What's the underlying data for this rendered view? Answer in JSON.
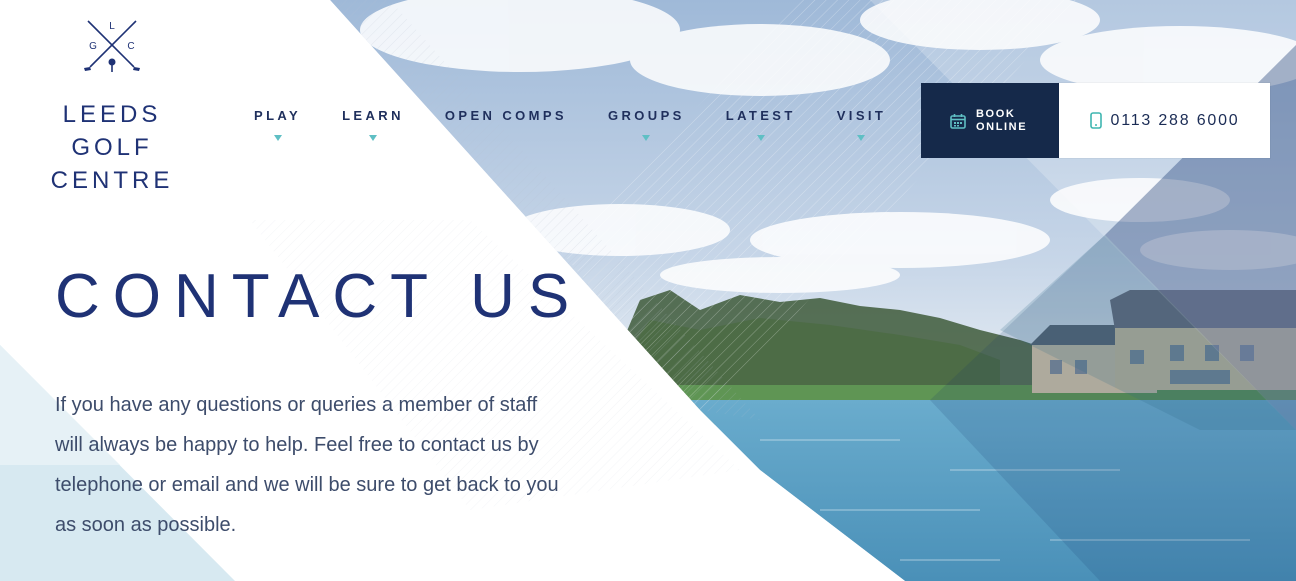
{
  "logo": {
    "initial_top": "L",
    "initial_left": "G",
    "initial_right": "C",
    "name_line_1": "LEEDS GOLF",
    "name_line_2": "CENTRE"
  },
  "nav": {
    "items": [
      {
        "label": "PLAY",
        "has_dropdown": true
      },
      {
        "label": "LEARN",
        "has_dropdown": true
      },
      {
        "label": "OPEN COMPS",
        "has_dropdown": false
      },
      {
        "label": "GROUPS",
        "has_dropdown": true
      },
      {
        "label": "LATEST",
        "has_dropdown": true
      },
      {
        "label": "VISIT",
        "has_dropdown": true
      }
    ]
  },
  "cta": {
    "book_label": "BOOK ONLINE",
    "book_icon": "calendar-icon",
    "phone_label": "0113 288 6000",
    "phone_icon": "mobile-phone-icon"
  },
  "hero": {
    "title": "CONTACT US",
    "body": "If you have any questions or queries a member of staff will always be happy to help. Feel free to contact us by telephone or email and we will be sure to get back to you as soon as possible."
  },
  "colors": {
    "navy": "#1f3275",
    "dark_button": "#15294a",
    "accent_teal": "#5fbfc4",
    "body_text": "#3d4c6b"
  }
}
